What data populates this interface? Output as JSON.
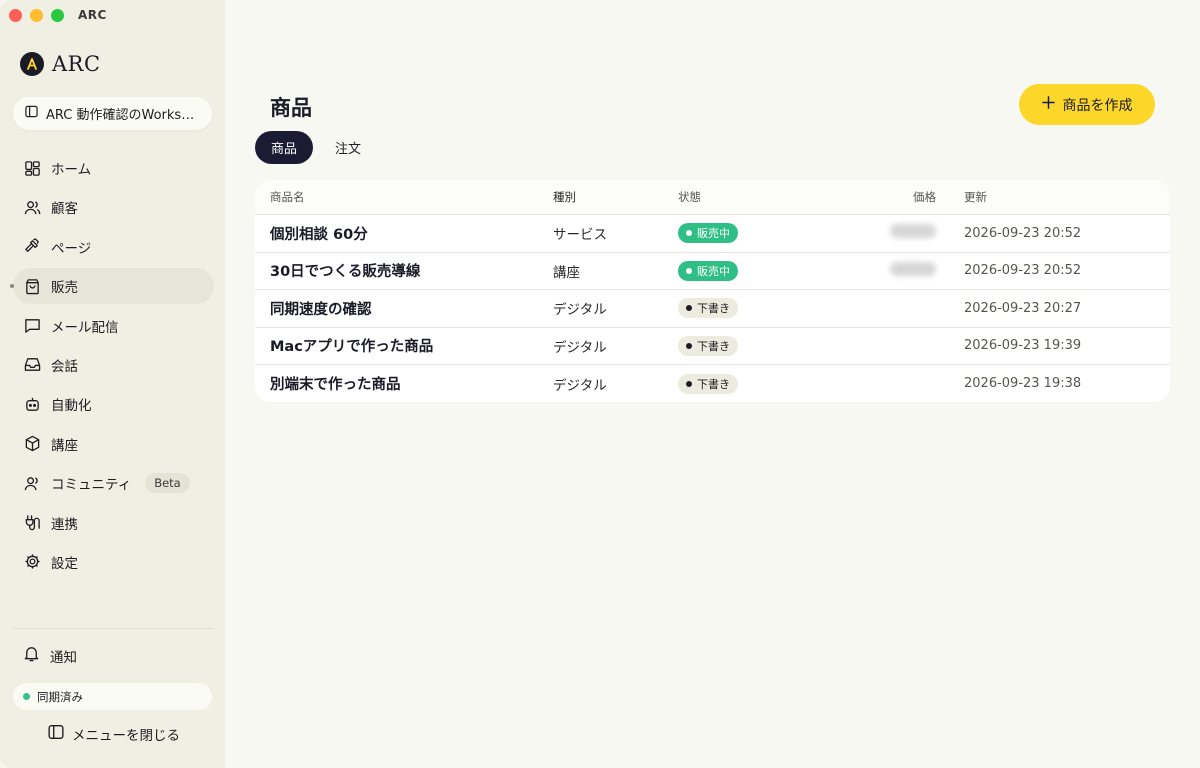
{
  "window": {
    "title": "ARC"
  },
  "sidebar": {
    "brand": "ARC",
    "workspace": "ARC 動作確認のWorksp...",
    "items": [
      {
        "label": "ホーム",
        "icon": "home-grid-icon"
      },
      {
        "label": "顧客",
        "icon": "users-icon"
      },
      {
        "label": "ページ",
        "icon": "hammer-icon"
      },
      {
        "label": "販売",
        "icon": "bag-icon"
      },
      {
        "label": "メール配信",
        "icon": "chat-icon"
      },
      {
        "label": "会話",
        "icon": "inbox-icon"
      },
      {
        "label": "自動化",
        "icon": "robot-icon"
      },
      {
        "label": "講座",
        "icon": "cube-icon"
      },
      {
        "label": "コミュニティ",
        "icon": "community-icon",
        "badge": "Beta"
      },
      {
        "label": "連携",
        "icon": "plug-icon"
      },
      {
        "label": "設定",
        "icon": "gear-icon"
      }
    ],
    "notify": "通知",
    "sync_status": "同期済み",
    "close_menu": "メニューを閉じる"
  },
  "main": {
    "title": "商品",
    "create_button": "商品を作成",
    "tabs": [
      "商品",
      "注文"
    ],
    "table": {
      "headers": {
        "name": "商品名",
        "type": "種別",
        "state": "状態",
        "price": "価格",
        "updated": "更新"
      },
      "rows": [
        {
          "name": "個別相談 60分",
          "type": "サービス",
          "state": "販売中",
          "updated": "2026-09-23 20:52"
        },
        {
          "name": "30日でつくる販売導線",
          "type": "講座",
          "state": "販売中",
          "updated": "2026-09-23 20:52"
        },
        {
          "name": "同期速度の確認",
          "type": "デジタル",
          "state": "下書き",
          "updated": "2026-09-23 20:27"
        },
        {
          "name": "Macアプリで作った商品",
          "type": "デジタル",
          "state": "下書き",
          "updated": "2026-09-23 19:39"
        },
        {
          "name": "別端末で作った商品",
          "type": "デジタル",
          "state": "下書き",
          "updated": "2026-09-23 19:38"
        }
      ]
    }
  },
  "colors": {
    "accent": "#fcd72a",
    "sale": "#2fbf86",
    "dark": "#1b1b33"
  }
}
